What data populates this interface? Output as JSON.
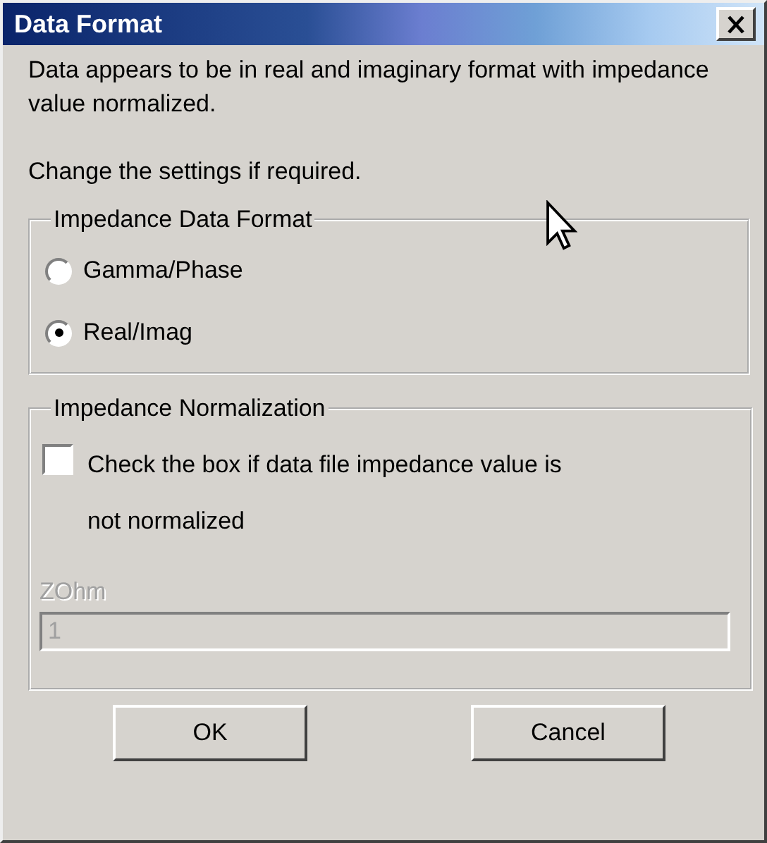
{
  "window": {
    "title": "Data Format"
  },
  "message": "Data appears to be in real and imaginary format with impedance value normalized.",
  "hint": "Change the settings if required.",
  "format_group": {
    "title": "Impedance Data Format",
    "options": [
      {
        "label": "Gamma/Phase",
        "selected": false
      },
      {
        "label": "Real/Imag",
        "selected": true
      }
    ]
  },
  "normalization_group": {
    "title": "Impedance Normalization",
    "checkbox": {
      "label": "Check the box if data file impedance value is not normalized",
      "checked": false
    },
    "field": {
      "label": "ZOhm",
      "value": "1",
      "disabled": true
    }
  },
  "buttons": [
    "OK",
    "Cancel"
  ]
}
